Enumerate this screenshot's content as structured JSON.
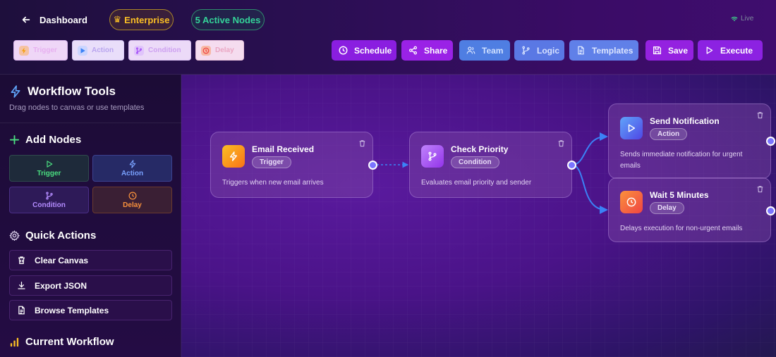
{
  "header": {
    "back_label": "Dashboard",
    "plan_badge": "Enterprise",
    "nodes_badge": "5 Active Nodes",
    "live_label": "Live",
    "mini_nodes": [
      "Trigger",
      "Action",
      "Condition",
      "Delay"
    ],
    "toolbar": {
      "schedule": "Schedule",
      "share": "Share",
      "team": "Team",
      "logic": "Logic",
      "templates": "Templates",
      "save": "Save",
      "execute": "Execute"
    }
  },
  "sidebar": {
    "title": "Workflow Tools",
    "subtitle": "Drag nodes to canvas or use templates",
    "add_nodes": {
      "heading": "Add Nodes",
      "items": [
        "Trigger",
        "Action",
        "Condition",
        "Delay"
      ]
    },
    "quick_actions": {
      "heading": "Quick Actions",
      "items": [
        "Clear Canvas",
        "Export JSON",
        "Browse Templates"
      ]
    },
    "current_workflow_heading": "Current Workflow"
  },
  "canvas": {
    "nodes": [
      {
        "title": "Email Received",
        "type": "Trigger",
        "description": "Triggers when new email arrives",
        "icon": "bolt-icon",
        "color": "#f59e0b"
      },
      {
        "title": "Check Priority",
        "type": "Condition",
        "description": "Evaluates email priority and sender",
        "icon": "git-branch-icon",
        "color": "#a855f7"
      },
      {
        "title": "Send Notification",
        "type": "Action",
        "description": "Sends immediate notification for urgent emails",
        "icon": "play-icon",
        "color": "#3b82f6"
      },
      {
        "title": "Wait 5 Minutes",
        "type": "Delay",
        "description": "Delays execution for non-urgent emails",
        "icon": "clock-icon",
        "color": "#ef4444"
      }
    ]
  },
  "colors": {
    "accent_purple": "#8a1ee0",
    "accent_blue": "#5a78e4",
    "gold": "#fbbf24",
    "green": "#34d399",
    "wire": "#3b82f6"
  }
}
